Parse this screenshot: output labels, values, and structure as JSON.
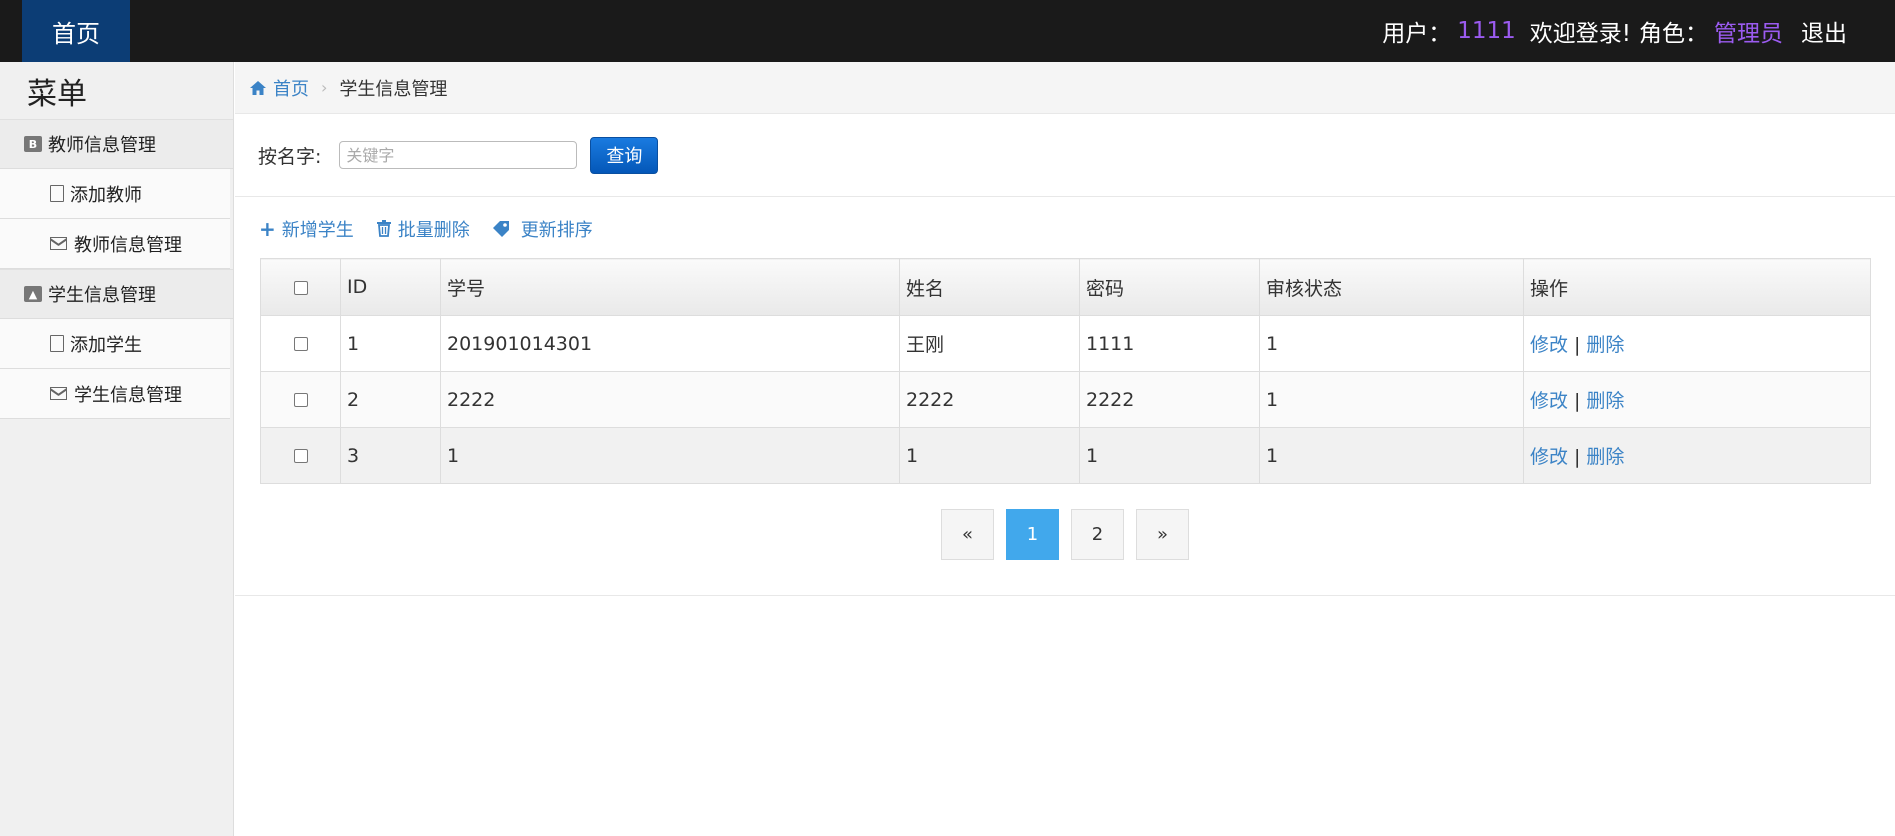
{
  "topbar": {
    "home_label": "首页",
    "user_label": "用户：",
    "user_value": "1111",
    "welcome": "欢迎登录!",
    "role_label": "角色：",
    "role_value": "管理员",
    "logout": "退出",
    "accent_color": "#9b5bf0"
  },
  "sidebar": {
    "title": "菜单",
    "groups": [
      {
        "label": "教师信息管理",
        "icon": "bold-b-icon",
        "items": [
          {
            "label": "添加教师",
            "icon": "file-icon"
          },
          {
            "label": "教师信息管理",
            "icon": "envelope-icon"
          }
        ]
      },
      {
        "label": "学生信息管理",
        "icon": "picture-icon",
        "items": [
          {
            "label": "添加学生",
            "icon": "file-icon"
          },
          {
            "label": "学生信息管理",
            "icon": "envelope-icon"
          }
        ]
      }
    ]
  },
  "breadcrumb": {
    "home": "首页",
    "current": "学生信息管理"
  },
  "search": {
    "label": "按名字:",
    "placeholder": "关键字",
    "value": "",
    "button": "查询"
  },
  "actions": {
    "add": "新增学生",
    "batch_delete": "批量删除",
    "reorder": "更新排序"
  },
  "table": {
    "headers": [
      "",
      "ID",
      "学号",
      "姓名",
      "密码",
      "审核状态",
      "操作"
    ],
    "rows": [
      {
        "id": "1",
        "sno": "201901014301",
        "name": "王刚",
        "pwd": "1111",
        "status": "1"
      },
      {
        "id": "2",
        "sno": "2222",
        "name": "2222",
        "pwd": "2222",
        "status": "1"
      },
      {
        "id": "3",
        "sno": "1",
        "name": "1",
        "pwd": "1",
        "status": "1"
      }
    ],
    "edit": "修改",
    "delete": "删除",
    "pipe": "|"
  },
  "pager": {
    "prev": "«",
    "pages": [
      "1",
      "2"
    ],
    "current": "1",
    "next": "»"
  }
}
